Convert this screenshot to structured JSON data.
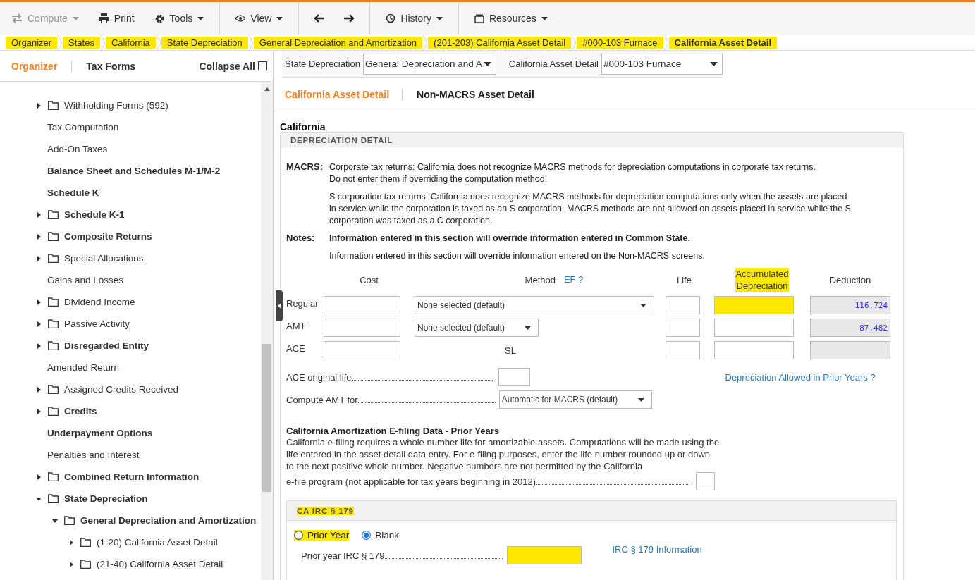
{
  "toolbar": {
    "groups": [
      [
        {
          "label": "Compute",
          "disabled": true,
          "caret": true
        },
        {
          "label": "Print",
          "disabled": false,
          "caret": false
        },
        {
          "label": "Tools",
          "disabled": false,
          "caret": true
        }
      ],
      [
        {
          "label": "View",
          "disabled": false,
          "caret": true
        }
      ],
      [
        {
          "kind": "back"
        },
        {
          "kind": "forward"
        }
      ],
      [
        {
          "label": "History",
          "disabled": false,
          "caret": true
        }
      ],
      [
        {
          "label": "Resources",
          "disabled": false,
          "caret": true
        }
      ]
    ]
  },
  "breadcrumb": [
    {
      "label": "Organizer",
      "selected": false,
      "highlighted": true
    },
    {
      "label": "States",
      "selected": false,
      "highlighted": true
    },
    {
      "label": "California",
      "selected": false,
      "highlighted": true
    },
    {
      "label": "State Depreciation",
      "selected": false,
      "highlighted": true
    },
    {
      "label": "General Depreciation and Amortization",
      "selected": false,
      "highlighted": true
    },
    {
      "label": "(201-203) California Asset Detail",
      "selected": false,
      "highlighted": true
    },
    {
      "label": "#000-103 Furnace",
      "selected": false,
      "highlighted": true
    },
    {
      "label": "California Asset Detail",
      "selected": true,
      "highlighted": true
    }
  ],
  "sidebar": {
    "tabs": [
      {
        "label": "Organizer",
        "selected": true
      },
      {
        "label": "Tax Forms",
        "selected": false
      }
    ],
    "collapse_all": "Collapse All",
    "tree": [
      {
        "label": "Withholding Forms (592)",
        "kind": "folder",
        "bold": false,
        "expanded": false
      },
      {
        "label": "Tax Computation",
        "kind": "page",
        "bold": false
      },
      {
        "label": "Add-On Taxes",
        "kind": "page",
        "bold": false
      },
      {
        "label": "Balance Sheet and Schedules M-1/M-2",
        "kind": "page",
        "bold": true
      },
      {
        "label": "Schedule K",
        "kind": "page",
        "bold": true
      },
      {
        "label": "Schedule K-1",
        "kind": "folder",
        "bold": true,
        "expanded": false
      },
      {
        "label": "Composite Returns",
        "kind": "folder",
        "bold": true,
        "expanded": false
      },
      {
        "label": "Special Allocations",
        "kind": "folder",
        "bold": false,
        "expanded": false
      },
      {
        "label": "Gains and Losses",
        "kind": "page",
        "bold": false
      },
      {
        "label": "Dividend Income",
        "kind": "folder",
        "bold": false,
        "expanded": false
      },
      {
        "label": "Passive Activity",
        "kind": "folder",
        "bold": false,
        "expanded": false
      },
      {
        "label": "Disregarded Entity",
        "kind": "folder",
        "bold": true,
        "expanded": false
      },
      {
        "label": "Amended Return",
        "kind": "page",
        "bold": false
      },
      {
        "label": "Assigned Credits Received",
        "kind": "folder",
        "bold": false,
        "expanded": false
      },
      {
        "label": "Credits",
        "kind": "folder",
        "bold": true,
        "expanded": false
      },
      {
        "label": "Underpayment Options",
        "kind": "page",
        "bold": true
      },
      {
        "label": "Penalties and Interest",
        "kind": "page",
        "bold": false
      },
      {
        "label": "Combined Return Information",
        "kind": "folder",
        "bold": true,
        "expanded": false
      },
      {
        "label": "State Depreciation",
        "kind": "folder",
        "bold": true,
        "expanded": true,
        "children": [
          {
            "label": "General Depreciation and Amortization",
            "kind": "folder",
            "bold": true,
            "expanded": true,
            "children": [
              {
                "label": "(1-20) California Asset Detail",
                "kind": "folder",
                "bold": false,
                "expanded": false
              },
              {
                "label": "(21-40) California Asset Detail",
                "kind": "folder",
                "bold": false,
                "expanded": false
              }
            ]
          }
        ]
      }
    ]
  },
  "selectors": [
    {
      "label": "State Depreciation",
      "value": "General Depreciation and A"
    },
    {
      "label": "California Asset Detail",
      "value": "#000-103 Furnace"
    }
  ],
  "tabs": [
    {
      "label": "California Asset Detail",
      "selected": true
    },
    {
      "label": "Non-MACRS Asset Detail",
      "selected": false
    }
  ],
  "state_title": "California",
  "depreciation": {
    "title": "DEPRECIATION DETAIL",
    "notes": [
      {
        "label": "MACRS:",
        "paragraphs": [
          {
            "text": "Corporate tax returns: California does not recognize MACRS methods for depreciation computations in corporate tax returns.\nDo not enter them if overriding the computation method.",
            "bold": false
          },
          {
            "text": "S corporation tax returns: California does recognize MACRS methods for depreciation computations only when the assets are placed in service while the corporation is taxed as an S corporation. MACRS methods are not allowed on assets placed in service while the S corporation was taxed as a C corporation.",
            "bold": false
          }
        ]
      },
      {
        "label": "Notes:",
        "paragraphs": [
          {
            "text": "Information entered in this section will override information entered in Common State.",
            "bold": true
          },
          {
            "text": "Information entered in this section will override information entered on the Non-MACRS screens.",
            "bold": false
          }
        ]
      }
    ],
    "columns": {
      "cost": "Cost",
      "method": "Method",
      "method_link": "EF ?",
      "life": "Life",
      "accumulated": {
        "label": "Accumulated\nDepreciation",
        "highlighted": true
      },
      "deduction": "Deduction"
    },
    "rows": [
      {
        "label": "Regular",
        "method": {
          "kind": "wide-select",
          "value": "None selected (default)"
        },
        "accumulated_highlighted": true,
        "deduction": "116,724"
      },
      {
        "label": "AMT",
        "method": {
          "kind": "narrow-select",
          "value": "None selected (default)"
        },
        "accumulated_highlighted": false,
        "deduction": "87,482"
      },
      {
        "label": "ACE",
        "method": {
          "kind": "text",
          "value": "SL"
        },
        "accumulated_highlighted": false
      }
    ],
    "ace_original_life": "ACE original life",
    "compute_amt": {
      "label": "Compute AMT for",
      "value": "Automatic for MACRS (default)"
    },
    "prior_years_link": "Depreciation Allowed in Prior Years ?",
    "amortization": {
      "title": "California Amortization E-filing Data - Prior Years",
      "text": "California e-filing requires a whole number life for amortizable assets. Computations will be made using the life entered in the asset detail data entry. For e-filing purposes, enter the life number rounded up or down to the next positive whole number. Negative numbers are not permitted by the California",
      "last_line": "e-file program (not applicable for tax years beginning in 2012)"
    }
  },
  "irc179": {
    "title": "CA IRC § 179",
    "title_highlighted": true,
    "radios": [
      {
        "label": "Prior Year",
        "selected": false,
        "highlighted": true
      },
      {
        "label": "Blank",
        "selected": true,
        "highlighted": false
      }
    ],
    "field": {
      "label": "Prior year IRC § 179",
      "highlighted": true
    },
    "link": "IRC § 179 Information"
  }
}
